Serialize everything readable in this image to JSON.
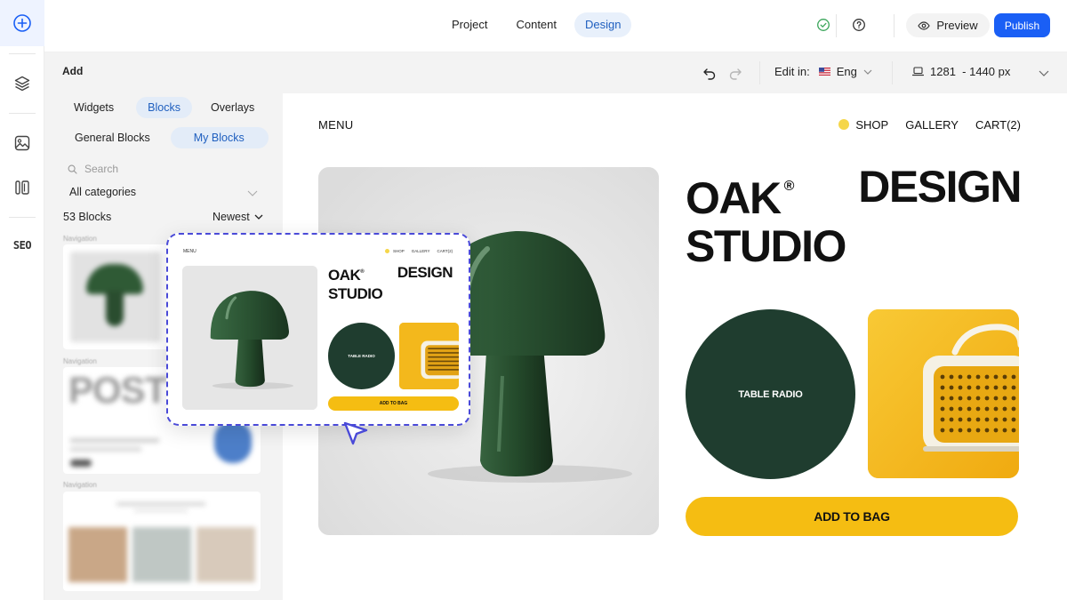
{
  "rail": {
    "seo_label": "SEO"
  },
  "topbar": {
    "tabs": [
      {
        "label": "Project",
        "active": false
      },
      {
        "label": "Content",
        "active": false
      },
      {
        "label": "Design",
        "active": true
      }
    ],
    "preview_label": "Preview",
    "publish_label": "Publish"
  },
  "subbar": {
    "add_title": "Add",
    "edit_in_label": "Edit in:",
    "language": "Eng",
    "breakpoint": "1281  - 1440 px"
  },
  "panel": {
    "tabs": [
      {
        "label": "Widgets",
        "active": false
      },
      {
        "label": "Blocks",
        "active": true
      },
      {
        "label": "Overlays",
        "active": false
      }
    ],
    "subtabs": [
      {
        "label": "General Blocks",
        "active": false
      },
      {
        "label": "My Blocks",
        "active": true
      }
    ],
    "search_placeholder": "Search",
    "category": "All categories",
    "count": "53 Blocks",
    "sort": "Newest",
    "section_labels": [
      "Navigation",
      "Navigation",
      "Navigation"
    ],
    "card_text": "POST"
  },
  "canvas": {
    "menu": "MENU",
    "nav": [
      "SHOP",
      "GALLERY",
      "CART(2)"
    ],
    "title_word1": "OAK",
    "title_mark": "®",
    "title_word2": "DESIGN",
    "title_word3": "STUDIO",
    "circle_label": "TABLE RADIO",
    "button_label": "ADD TO BAG"
  },
  "drag_preview": {
    "menu": "MENU",
    "nav": [
      "SHOP",
      "GALLERY",
      "CART(2)"
    ],
    "title_word1": "OAK",
    "title_mark": "®",
    "title_word2": "DESIGN",
    "title_word3": "STUDIO",
    "circle_label": "TABLE RADIO",
    "button_label": "ADD TO BAG"
  },
  "colors": {
    "accent_blue": "#1a5ff5",
    "active_tab_text": "#1f5fbf",
    "forest_green": "#1f3d2f",
    "mustard_yellow": "#f5bd12",
    "drag_outline": "#4a4ad8"
  }
}
